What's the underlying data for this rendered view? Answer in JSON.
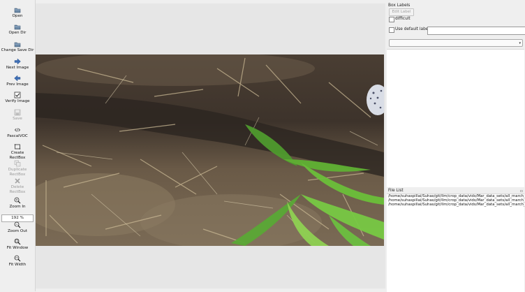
{
  "toolbar": {
    "open": "Open",
    "open_dir": "Open Dir",
    "change_save_dir": "Change Save Dir",
    "next_image": "Next Image",
    "prev_image": "Prev Image",
    "verify_image": "Verify Image",
    "save": "Save",
    "format": "PascalVOC",
    "create_rectbox": "Create\nRectBox",
    "duplicate_rectbox": "Duplicate\nRectBox",
    "delete_rectbox": "Delete\nRectBox",
    "zoom_in": "Zoom In",
    "zoom_value": "192 %",
    "zoom_out": "Zoom Out",
    "fit_window": "Fit Window",
    "fit_width": "Fit Width"
  },
  "dock": {
    "box_labels_title": "Box Labels",
    "edit_label": "Edit Label",
    "difficult": "difficult",
    "use_default_label": "Use default label",
    "default_label_value": "",
    "file_list_title": "File List",
    "files": [
      "/home/suhaspillai/Suhas/git/llm/crop_data/vids/Mar_data_sets/all_march_cluster",
      "/home/suhaspillai/Suhas/git/llm/crop_data/vids/Mar_data_sets/all_march_cluster",
      "/home/suhaspillai/Suhas/git/llm/crop_data/vids/Mar_data_sets/all_march_cluster"
    ]
  },
  "icons": {
    "open": "folder-icon",
    "open_dir": "folder-icon",
    "change_save_dir": "folder-icon",
    "next_image": "arrow-right-icon",
    "prev_image": "arrow-left-icon",
    "verify_image": "checkbox-icon",
    "save": "floppy-icon",
    "format": "code-icon",
    "create_rectbox": "rect-icon",
    "duplicate_rectbox": "duplicate-icon",
    "delete_rectbox": "delete-icon",
    "zoom_in": "zoom-in-icon",
    "zoom_out": "zoom-out-icon",
    "fit_window": "fit-window-icon",
    "fit_width": "fit-width-icon"
  }
}
